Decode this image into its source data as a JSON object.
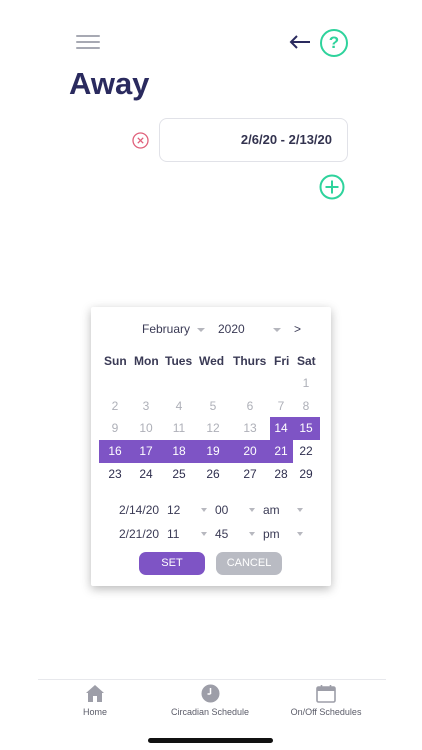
{
  "header": {
    "title": "Away"
  },
  "schedule": {
    "range_value": "2/6/20 - 2/13/20"
  },
  "calendar": {
    "month": "February",
    "year": "2020",
    "next_label": ">",
    "weekdays": [
      "Sun",
      "Mon",
      "Tues",
      "Wed",
      "Thurs",
      "Fri",
      "Sat"
    ],
    "weeks": [
      [
        "",
        "",
        "",
        "",
        "",
        "",
        "1"
      ],
      [
        "2",
        "3",
        "4",
        "5",
        "6",
        "7",
        "8"
      ],
      [
        "9",
        "10",
        "11",
        "12",
        "13",
        "14",
        "15"
      ],
      [
        "16",
        "17",
        "18",
        "19",
        "20",
        "21",
        "22"
      ],
      [
        "23",
        "24",
        "25",
        "26",
        "27",
        "28",
        "29"
      ]
    ],
    "selected_range": {
      "start": "2/14/20",
      "end": "2/21/20"
    },
    "start_time": {
      "date": "2/14/20",
      "hour": "12",
      "minute": "00",
      "period": "am"
    },
    "end_time": {
      "date": "2/21/20",
      "hour": "11",
      "minute": "45",
      "period": "pm"
    },
    "set_label": "SET",
    "cancel_label": "CANCEL"
  },
  "tabbar": {
    "items": [
      {
        "label": "Home",
        "icon": "home-icon"
      },
      {
        "label": "Circadian Schedule",
        "icon": "clock-icon"
      },
      {
        "label": "On/Off Schedules",
        "icon": "calendar-icon"
      }
    ]
  },
  "colors": {
    "accent_purple": "#7e54c5",
    "accent_green": "#2ed39c",
    "remove_red": "#e0607a",
    "title_navy": "#2a2a5e"
  }
}
